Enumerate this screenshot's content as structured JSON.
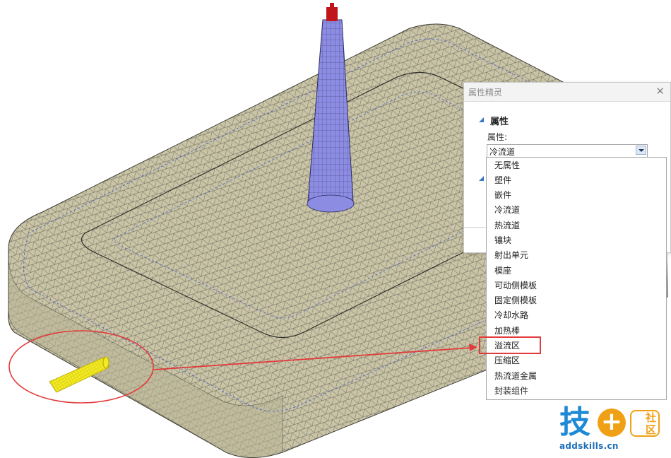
{
  "dialog": {
    "title": "属性精灵",
    "close_glyph": "✕",
    "section_label": "属性",
    "field_label": "属性:",
    "combo_value": "冷流道"
  },
  "dropdown": {
    "items": [
      "无属性",
      "塑件",
      "嵌件",
      "冷流道",
      "热流道",
      "镶块",
      "射出单元",
      "模座",
      "可动侧模板",
      "固定侧模板",
      "冷却水路",
      "加热棒",
      "溢流区",
      "压缩区",
      "热流道金属",
      "封装组件"
    ],
    "highlighted_item": "溢流区"
  },
  "logo": {
    "main": "技",
    "plus": "+",
    "badge_top": "社",
    "badge_bottom": "区",
    "url": "addskills.cn"
  },
  "colors": {
    "mesh_fill": "#c9c4a6",
    "mesh_line": "#55524a",
    "sprue": "#8a8ae0",
    "overflow": "#f2ea24",
    "highlight": "#e23b3b",
    "accent": "#3b78c8"
  }
}
